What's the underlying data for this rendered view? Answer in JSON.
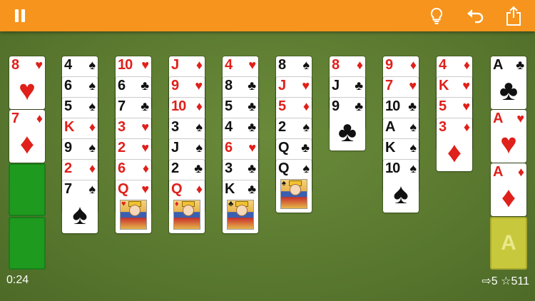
{
  "timer": "0:24",
  "moves": "5",
  "score": "511",
  "foundation_empty_label": "A",
  "cells": [
    {
      "rank": "8",
      "suit": "♥",
      "color": "red"
    },
    {
      "rank": "7",
      "suit": "♦",
      "color": "red"
    }
  ],
  "columns": [
    [
      {
        "rank": "4",
        "suit": "♠",
        "color": "black"
      },
      {
        "rank": "6",
        "suit": "♠",
        "color": "black"
      },
      {
        "rank": "5",
        "suit": "♠",
        "color": "black"
      },
      {
        "rank": "K",
        "suit": "♦",
        "color": "red"
      },
      {
        "rank": "9",
        "suit": "♠",
        "color": "black"
      },
      {
        "rank": "2",
        "suit": "♦",
        "color": "red"
      },
      {
        "rank": "7",
        "suit": "♠",
        "color": "black"
      }
    ],
    [
      {
        "rank": "10",
        "suit": "♥",
        "color": "red"
      },
      {
        "rank": "6",
        "suit": "♣",
        "color": "black"
      },
      {
        "rank": "7",
        "suit": "♣",
        "color": "black"
      },
      {
        "rank": "3",
        "suit": "♥",
        "color": "red"
      },
      {
        "rank": "2",
        "suit": "♥",
        "color": "red"
      },
      {
        "rank": "6",
        "suit": "♦",
        "color": "red"
      },
      {
        "rank": "Q",
        "suit": "♥",
        "color": "red"
      }
    ],
    [
      {
        "rank": "J",
        "suit": "♦",
        "color": "red"
      },
      {
        "rank": "9",
        "suit": "♥",
        "color": "red"
      },
      {
        "rank": "10",
        "suit": "♦",
        "color": "red"
      },
      {
        "rank": "3",
        "suit": "♠",
        "color": "black"
      },
      {
        "rank": "J",
        "suit": "♠",
        "color": "black"
      },
      {
        "rank": "2",
        "suit": "♣",
        "color": "black"
      },
      {
        "rank": "Q",
        "suit": "♦",
        "color": "red"
      }
    ],
    [
      {
        "rank": "4",
        "suit": "♥",
        "color": "red"
      },
      {
        "rank": "8",
        "suit": "♣",
        "color": "black"
      },
      {
        "rank": "5",
        "suit": "♣",
        "color": "black"
      },
      {
        "rank": "4",
        "suit": "♣",
        "color": "black"
      },
      {
        "rank": "6",
        "suit": "♥",
        "color": "red"
      },
      {
        "rank": "3",
        "suit": "♣",
        "color": "black"
      },
      {
        "rank": "K",
        "suit": "♣",
        "color": "black"
      }
    ],
    [
      {
        "rank": "8",
        "suit": "♠",
        "color": "black"
      },
      {
        "rank": "J",
        "suit": "♥",
        "color": "red"
      },
      {
        "rank": "5",
        "suit": "♦",
        "color": "red"
      },
      {
        "rank": "2",
        "suit": "♠",
        "color": "black"
      },
      {
        "rank": "Q",
        "suit": "♣",
        "color": "black"
      },
      {
        "rank": "Q",
        "suit": "♠",
        "color": "black"
      }
    ],
    [
      {
        "rank": "8",
        "suit": "♦",
        "color": "red"
      },
      {
        "rank": "J",
        "suit": "♣",
        "color": "black"
      },
      {
        "rank": "9",
        "suit": "♣",
        "color": "black"
      }
    ],
    [
      {
        "rank": "9",
        "suit": "♦",
        "color": "red"
      },
      {
        "rank": "7",
        "suit": "♥",
        "color": "red"
      },
      {
        "rank": "10",
        "suit": "♣",
        "color": "black"
      },
      {
        "rank": "A",
        "suit": "♠",
        "color": "black"
      },
      {
        "rank": "K",
        "suit": "♠",
        "color": "black"
      },
      {
        "rank": "10",
        "suit": "♠",
        "color": "black"
      }
    ],
    [
      {
        "rank": "4",
        "suit": "♦",
        "color": "red"
      },
      {
        "rank": "K",
        "suit": "♥",
        "color": "red"
      },
      {
        "rank": "5",
        "suit": "♥",
        "color": "red"
      },
      {
        "rank": "3",
        "suit": "♦",
        "color": "red"
      }
    ]
  ],
  "foundations": [
    {
      "rank": "A",
      "suit": "♣",
      "color": "black"
    },
    {
      "rank": "A",
      "suit": "♥",
      "color": "red"
    },
    {
      "rank": "A",
      "suit": "♦",
      "color": "red"
    }
  ],
  "icons": {
    "pause": "pause-icon",
    "hint": "lightbulb-icon",
    "undo": "undo-icon",
    "share": "share-icon",
    "moves": "arrow-right-icon",
    "score": "star-icon"
  },
  "colors": {
    "topbar": "#f7941d",
    "felt": "#5c7a32",
    "red_suit": "#e0201a",
    "black_suit": "#111111",
    "free_cell": "#1e9a1e",
    "foundation_slot": "#c8c83c"
  }
}
